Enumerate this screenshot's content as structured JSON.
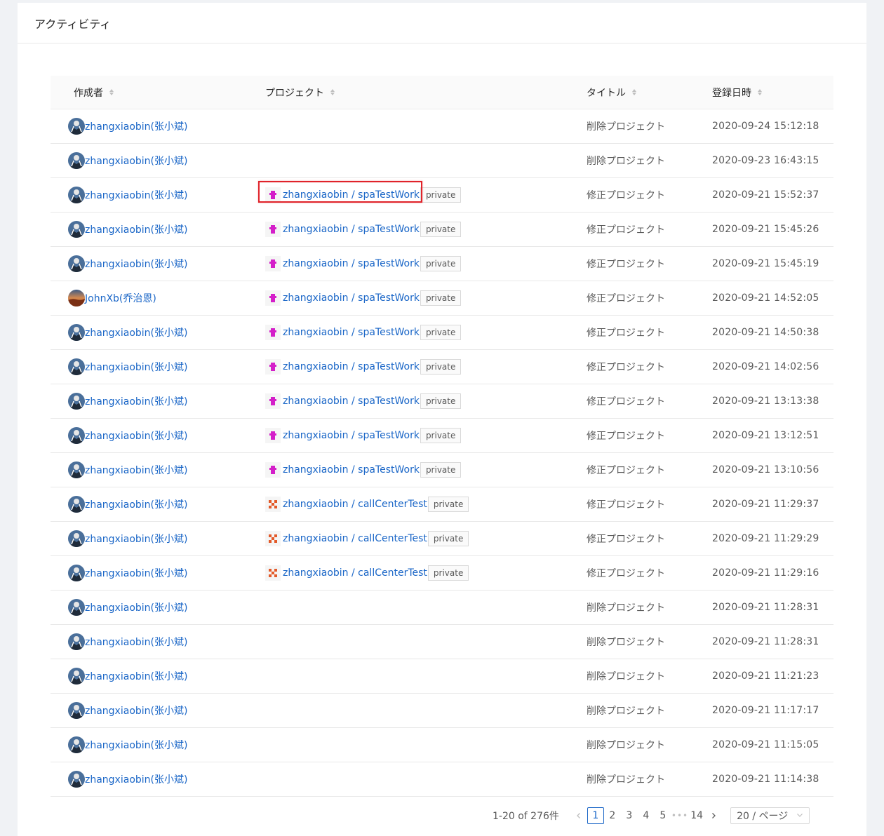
{
  "header": {
    "title": "アクティビティ"
  },
  "table": {
    "columns": [
      "作成者",
      "プロジェクト",
      "タイトル",
      "登録日時"
    ],
    "rows": [
      {
        "author": "zhangxiaobin(张小斌)",
        "avatar": "photo",
        "project": "",
        "projectIcon": "",
        "tag": "",
        "title": "削除プロジェクト",
        "time": "2020-09-24 15:12:18"
      },
      {
        "author": "zhangxiaobin(张小斌)",
        "avatar": "photo",
        "project": "",
        "projectIcon": "",
        "tag": "",
        "title": "削除プロジェクト",
        "time": "2020-09-23 16:43:15"
      },
      {
        "author": "zhangxiaobin(张小斌)",
        "avatar": "photo",
        "project": "zhangxiaobin / spaTestWork",
        "projectIcon": "magenta",
        "tag": "private",
        "title": "修正プロジェクト",
        "time": "2020-09-21 15:52:37",
        "highlighted": true
      },
      {
        "author": "zhangxiaobin(张小斌)",
        "avatar": "photo",
        "project": "zhangxiaobin / spaTestWork",
        "projectIcon": "magenta",
        "tag": "private",
        "title": "修正プロジェクト",
        "time": "2020-09-21 15:45:26"
      },
      {
        "author": "zhangxiaobin(张小斌)",
        "avatar": "photo",
        "project": "zhangxiaobin / spaTestWork",
        "projectIcon": "magenta",
        "tag": "private",
        "title": "修正プロジェクト",
        "time": "2020-09-21 15:45:19"
      },
      {
        "author": "JohnXb(乔治恩)",
        "avatar": "sunset",
        "project": "zhangxiaobin / spaTestWork",
        "projectIcon": "magenta",
        "tag": "private",
        "title": "修正プロジェクト",
        "time": "2020-09-21 14:52:05"
      },
      {
        "author": "zhangxiaobin(张小斌)",
        "avatar": "photo",
        "project": "zhangxiaobin / spaTestWork",
        "projectIcon": "magenta",
        "tag": "private",
        "title": "修正プロジェクト",
        "time": "2020-09-21 14:50:38"
      },
      {
        "author": "zhangxiaobin(张小斌)",
        "avatar": "photo",
        "project": "zhangxiaobin / spaTestWork",
        "projectIcon": "magenta",
        "tag": "private",
        "title": "修正プロジェクト",
        "time": "2020-09-21 14:02:56"
      },
      {
        "author": "zhangxiaobin(张小斌)",
        "avatar": "photo",
        "project": "zhangxiaobin / spaTestWork",
        "projectIcon": "magenta",
        "tag": "private",
        "title": "修正プロジェクト",
        "time": "2020-09-21 13:13:38"
      },
      {
        "author": "zhangxiaobin(张小斌)",
        "avatar": "photo",
        "project": "zhangxiaobin / spaTestWork",
        "projectIcon": "magenta",
        "tag": "private",
        "title": "修正プロジェクト",
        "time": "2020-09-21 13:12:51"
      },
      {
        "author": "zhangxiaobin(张小斌)",
        "avatar": "photo",
        "project": "zhangxiaobin / spaTestWork",
        "projectIcon": "magenta",
        "tag": "private",
        "title": "修正プロジェクト",
        "time": "2020-09-21 13:10:56"
      },
      {
        "author": "zhangxiaobin(张小斌)",
        "avatar": "photo",
        "project": "zhangxiaobin / callCenterTest",
        "projectIcon": "orange",
        "tag": "private",
        "title": "修正プロジェクト",
        "time": "2020-09-21 11:29:37"
      },
      {
        "author": "zhangxiaobin(张小斌)",
        "avatar": "photo",
        "project": "zhangxiaobin / callCenterTest",
        "projectIcon": "orange",
        "tag": "private",
        "title": "修正プロジェクト",
        "time": "2020-09-21 11:29:29"
      },
      {
        "author": "zhangxiaobin(张小斌)",
        "avatar": "photo",
        "project": "zhangxiaobin / callCenterTest",
        "projectIcon": "orange",
        "tag": "private",
        "title": "修正プロジェクト",
        "time": "2020-09-21 11:29:16"
      },
      {
        "author": "zhangxiaobin(张小斌)",
        "avatar": "photo",
        "project": "",
        "projectIcon": "",
        "tag": "",
        "title": "削除プロジェクト",
        "time": "2020-09-21 11:28:31"
      },
      {
        "author": "zhangxiaobin(张小斌)",
        "avatar": "photo",
        "project": "",
        "projectIcon": "",
        "tag": "",
        "title": "削除プロジェクト",
        "time": "2020-09-21 11:28:31"
      },
      {
        "author": "zhangxiaobin(张小斌)",
        "avatar": "photo",
        "project": "",
        "projectIcon": "",
        "tag": "",
        "title": "削除プロジェクト",
        "time": "2020-09-21 11:21:23"
      },
      {
        "author": "zhangxiaobin(张小斌)",
        "avatar": "photo",
        "project": "",
        "projectIcon": "",
        "tag": "",
        "title": "削除プロジェクト",
        "time": "2020-09-21 11:17:17"
      },
      {
        "author": "zhangxiaobin(张小斌)",
        "avatar": "photo",
        "project": "",
        "projectIcon": "",
        "tag": "",
        "title": "削除プロジェクト",
        "time": "2020-09-21 11:15:05"
      },
      {
        "author": "zhangxiaobin(张小斌)",
        "avatar": "photo",
        "project": "",
        "projectIcon": "",
        "tag": "",
        "title": "削除プロジェクト",
        "time": "2020-09-21 11:14:38"
      }
    ]
  },
  "pagination": {
    "total_text": "1-20 of 276件",
    "prev_icon": "chevron-left-icon",
    "next_icon": "chevron-right-icon",
    "pages": [
      "1",
      "2",
      "3",
      "4",
      "5",
      "•••",
      "14"
    ],
    "current": "1",
    "page_size": "20 / ページ",
    "page_size_icon": "chevron-down-icon"
  },
  "colors": {
    "link": "#1a66c7",
    "highlight_border": "#e0232a",
    "icon_magenta": "#d41ec9",
    "icon_orange": "#e35a29"
  }
}
